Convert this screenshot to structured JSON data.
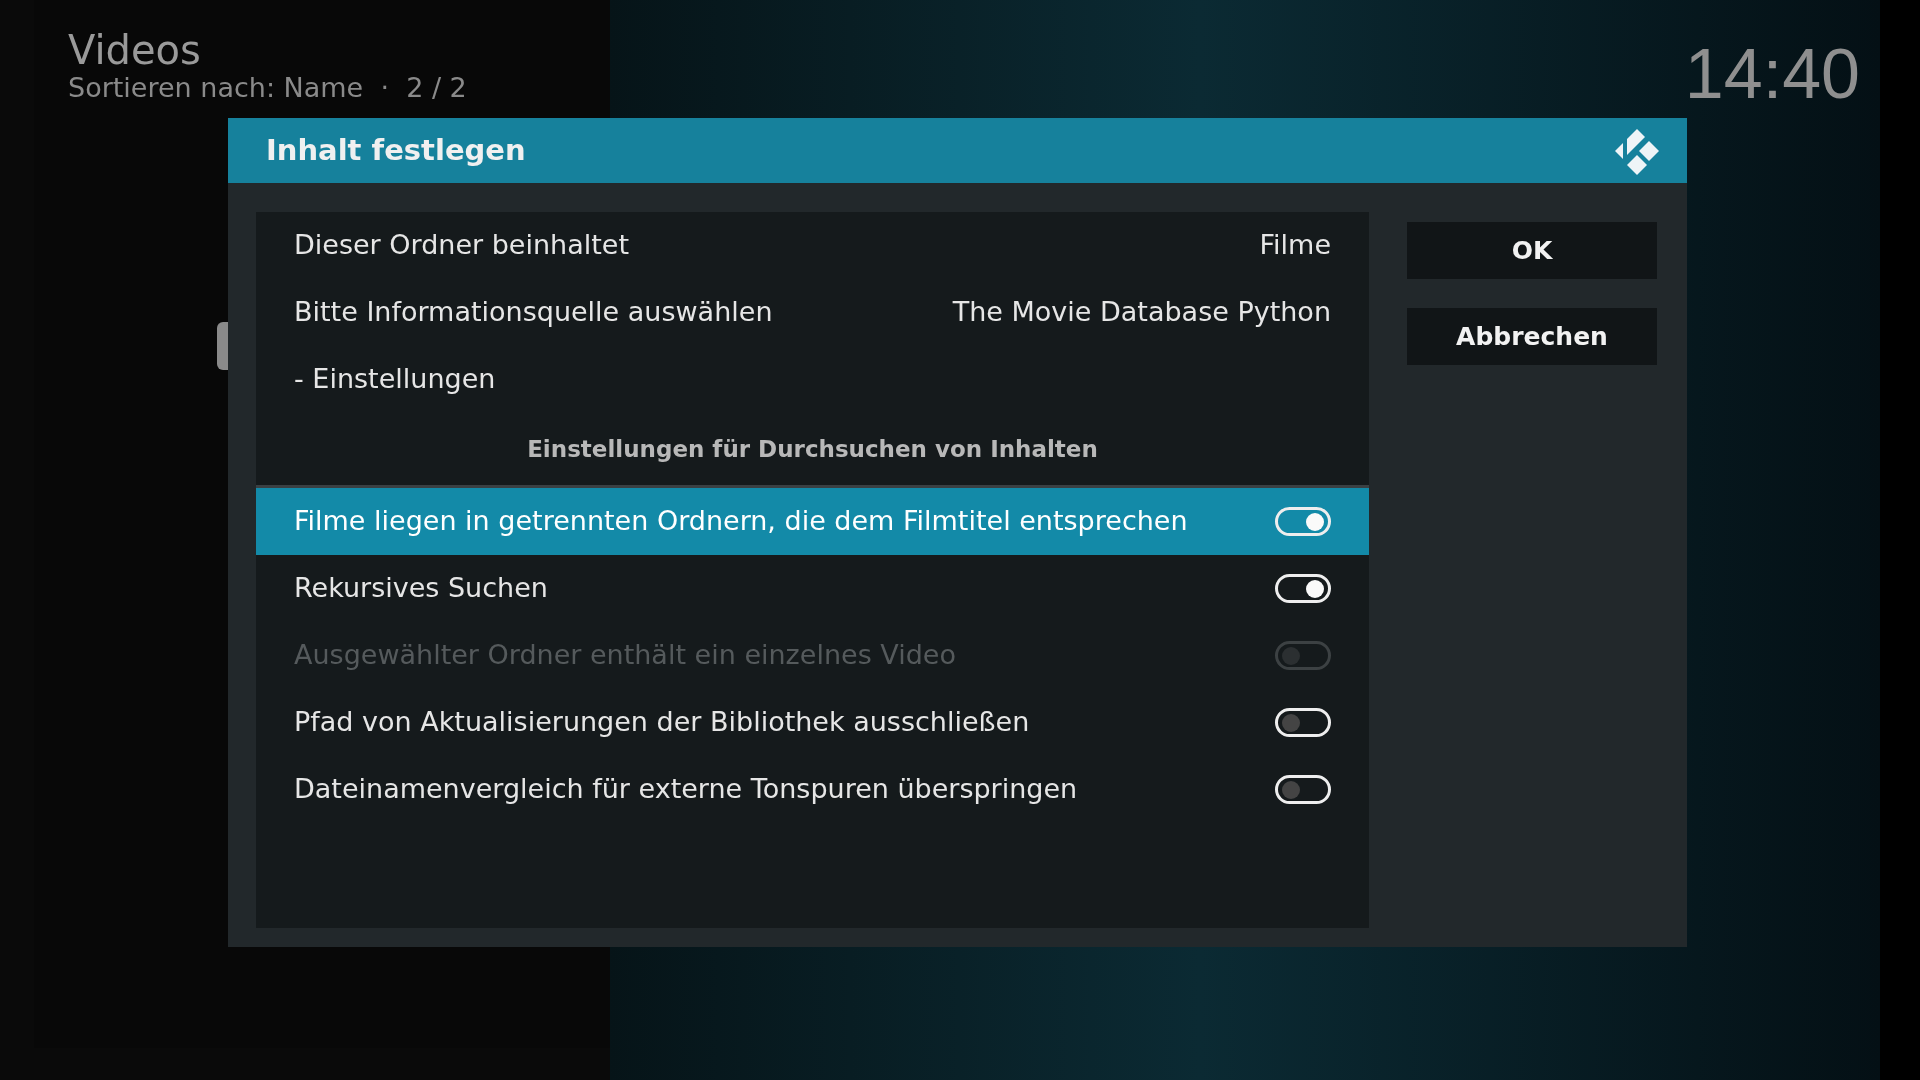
{
  "window": {
    "title": "Videos",
    "subtitle": "Sortieren nach: Name  ·  2 / 2",
    "clock": "14:40"
  },
  "dialog": {
    "title": "Inhalt festlegen",
    "items": [
      {
        "kind": "value",
        "label": "Dieser Ordner beinhaltet",
        "value": "Filme",
        "selected": false
      },
      {
        "kind": "value",
        "label": "Bitte Informationsquelle auswählen",
        "value": "The Movie Database Python",
        "selected": false
      },
      {
        "kind": "link",
        "label": "- Einstellungen",
        "selected": false
      },
      {
        "kind": "heading",
        "label": "Einstellungen für Durchsuchen von Inhalten"
      },
      {
        "kind": "toggle",
        "label": "Filme liegen in getrennten Ordnern, die dem Filmtitel entsprechen",
        "on": true,
        "disabled": false,
        "selected": true
      },
      {
        "kind": "toggle",
        "label": "Rekursives Suchen",
        "on": true,
        "disabled": false,
        "selected": false
      },
      {
        "kind": "toggle",
        "label": "Ausgewählter Ordner enthält ein einzelnes Video",
        "on": false,
        "disabled": true,
        "selected": false
      },
      {
        "kind": "toggle",
        "label": "Pfad von Aktualisierungen der Bibliothek ausschließen",
        "on": false,
        "disabled": false,
        "selected": false
      },
      {
        "kind": "toggle",
        "label": "Dateinamenvergleich für externe Tonspuren überspringen",
        "on": false,
        "disabled": false,
        "selected": false
      }
    ],
    "buttons": [
      "OK",
      "Abbrechen"
    ]
  }
}
